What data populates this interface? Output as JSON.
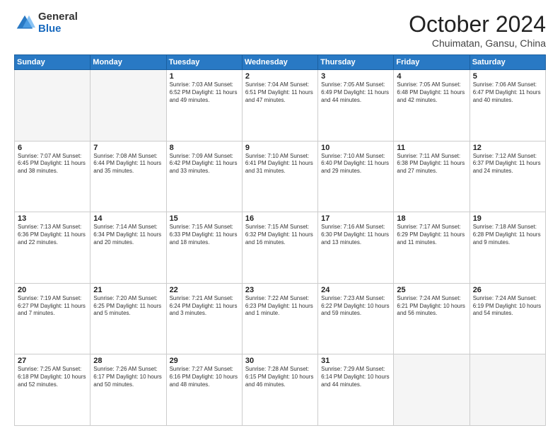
{
  "header": {
    "logo_general": "General",
    "logo_blue": "Blue",
    "title": "October 2024",
    "location": "Chuimatan, Gansu, China"
  },
  "days_of_week": [
    "Sunday",
    "Monday",
    "Tuesday",
    "Wednesday",
    "Thursday",
    "Friday",
    "Saturday"
  ],
  "weeks": [
    [
      {
        "day": "",
        "info": ""
      },
      {
        "day": "",
        "info": ""
      },
      {
        "day": "1",
        "info": "Sunrise: 7:03 AM\nSunset: 6:52 PM\nDaylight: 11 hours\nand 49 minutes."
      },
      {
        "day": "2",
        "info": "Sunrise: 7:04 AM\nSunset: 6:51 PM\nDaylight: 11 hours\nand 47 minutes."
      },
      {
        "day": "3",
        "info": "Sunrise: 7:05 AM\nSunset: 6:49 PM\nDaylight: 11 hours\nand 44 minutes."
      },
      {
        "day": "4",
        "info": "Sunrise: 7:05 AM\nSunset: 6:48 PM\nDaylight: 11 hours\nand 42 minutes."
      },
      {
        "day": "5",
        "info": "Sunrise: 7:06 AM\nSunset: 6:47 PM\nDaylight: 11 hours\nand 40 minutes."
      }
    ],
    [
      {
        "day": "6",
        "info": "Sunrise: 7:07 AM\nSunset: 6:45 PM\nDaylight: 11 hours\nand 38 minutes."
      },
      {
        "day": "7",
        "info": "Sunrise: 7:08 AM\nSunset: 6:44 PM\nDaylight: 11 hours\nand 35 minutes."
      },
      {
        "day": "8",
        "info": "Sunrise: 7:09 AM\nSunset: 6:42 PM\nDaylight: 11 hours\nand 33 minutes."
      },
      {
        "day": "9",
        "info": "Sunrise: 7:10 AM\nSunset: 6:41 PM\nDaylight: 11 hours\nand 31 minutes."
      },
      {
        "day": "10",
        "info": "Sunrise: 7:10 AM\nSunset: 6:40 PM\nDaylight: 11 hours\nand 29 minutes."
      },
      {
        "day": "11",
        "info": "Sunrise: 7:11 AM\nSunset: 6:38 PM\nDaylight: 11 hours\nand 27 minutes."
      },
      {
        "day": "12",
        "info": "Sunrise: 7:12 AM\nSunset: 6:37 PM\nDaylight: 11 hours\nand 24 minutes."
      }
    ],
    [
      {
        "day": "13",
        "info": "Sunrise: 7:13 AM\nSunset: 6:36 PM\nDaylight: 11 hours\nand 22 minutes."
      },
      {
        "day": "14",
        "info": "Sunrise: 7:14 AM\nSunset: 6:34 PM\nDaylight: 11 hours\nand 20 minutes."
      },
      {
        "day": "15",
        "info": "Sunrise: 7:15 AM\nSunset: 6:33 PM\nDaylight: 11 hours\nand 18 minutes."
      },
      {
        "day": "16",
        "info": "Sunrise: 7:15 AM\nSunset: 6:32 PM\nDaylight: 11 hours\nand 16 minutes."
      },
      {
        "day": "17",
        "info": "Sunrise: 7:16 AM\nSunset: 6:30 PM\nDaylight: 11 hours\nand 13 minutes."
      },
      {
        "day": "18",
        "info": "Sunrise: 7:17 AM\nSunset: 6:29 PM\nDaylight: 11 hours\nand 11 minutes."
      },
      {
        "day": "19",
        "info": "Sunrise: 7:18 AM\nSunset: 6:28 PM\nDaylight: 11 hours\nand 9 minutes."
      }
    ],
    [
      {
        "day": "20",
        "info": "Sunrise: 7:19 AM\nSunset: 6:27 PM\nDaylight: 11 hours\nand 7 minutes."
      },
      {
        "day": "21",
        "info": "Sunrise: 7:20 AM\nSunset: 6:25 PM\nDaylight: 11 hours\nand 5 minutes."
      },
      {
        "day": "22",
        "info": "Sunrise: 7:21 AM\nSunset: 6:24 PM\nDaylight: 11 hours\nand 3 minutes."
      },
      {
        "day": "23",
        "info": "Sunrise: 7:22 AM\nSunset: 6:23 PM\nDaylight: 11 hours\nand 1 minute."
      },
      {
        "day": "24",
        "info": "Sunrise: 7:23 AM\nSunset: 6:22 PM\nDaylight: 10 hours\nand 59 minutes."
      },
      {
        "day": "25",
        "info": "Sunrise: 7:24 AM\nSunset: 6:21 PM\nDaylight: 10 hours\nand 56 minutes."
      },
      {
        "day": "26",
        "info": "Sunrise: 7:24 AM\nSunset: 6:19 PM\nDaylight: 10 hours\nand 54 minutes."
      }
    ],
    [
      {
        "day": "27",
        "info": "Sunrise: 7:25 AM\nSunset: 6:18 PM\nDaylight: 10 hours\nand 52 minutes."
      },
      {
        "day": "28",
        "info": "Sunrise: 7:26 AM\nSunset: 6:17 PM\nDaylight: 10 hours\nand 50 minutes."
      },
      {
        "day": "29",
        "info": "Sunrise: 7:27 AM\nSunset: 6:16 PM\nDaylight: 10 hours\nand 48 minutes."
      },
      {
        "day": "30",
        "info": "Sunrise: 7:28 AM\nSunset: 6:15 PM\nDaylight: 10 hours\nand 46 minutes."
      },
      {
        "day": "31",
        "info": "Sunrise: 7:29 AM\nSunset: 6:14 PM\nDaylight: 10 hours\nand 44 minutes."
      },
      {
        "day": "",
        "info": ""
      },
      {
        "day": "",
        "info": ""
      }
    ]
  ]
}
